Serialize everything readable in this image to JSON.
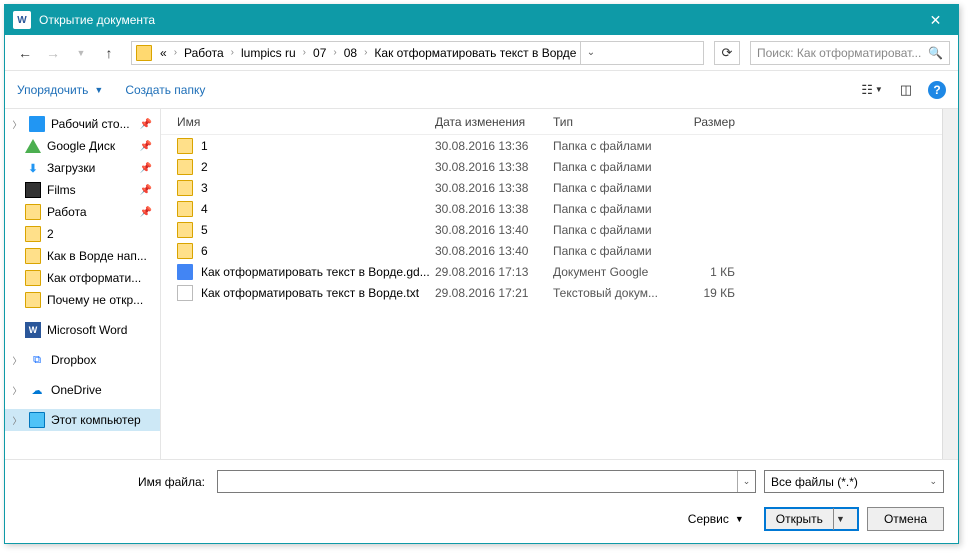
{
  "titlebar": {
    "app_badge": "W",
    "title": "Открытие документа"
  },
  "nav": {
    "breadcrumb": [
      "Работа",
      "lumpics ru",
      "07",
      "08",
      "Как отформатировать текст в Ворде"
    ],
    "search_placeholder": "Поиск: Как отформатироват..."
  },
  "toolbar": {
    "organize": "Упорядочить",
    "newfolder": "Создать папку"
  },
  "sidebar": [
    {
      "label": "Рабочий сто...",
      "icon": "desktop",
      "pin": true,
      "collapsible": true
    },
    {
      "label": "Google Диск",
      "icon": "gdrive",
      "pin": true
    },
    {
      "label": "Загрузки",
      "icon": "download",
      "pin": true
    },
    {
      "label": "Films",
      "icon": "films",
      "pin": true
    },
    {
      "label": "Работа",
      "icon": "folder",
      "pin": true
    },
    {
      "label": "2",
      "icon": "folder"
    },
    {
      "label": "Как в Ворде нап...",
      "icon": "folder"
    },
    {
      "label": "Как отформати...",
      "icon": "folder"
    },
    {
      "label": "Почему не откр...",
      "icon": "folder"
    },
    {
      "label": "",
      "icon": "spacer"
    },
    {
      "label": "Microsoft Word",
      "icon": "word"
    },
    {
      "label": "",
      "icon": "spacer"
    },
    {
      "label": "Dropbox",
      "icon": "dropbox",
      "collapsible": true
    },
    {
      "label": "",
      "icon": "spacer"
    },
    {
      "label": "OneDrive",
      "icon": "onedrive",
      "collapsible": true
    },
    {
      "label": "",
      "icon": "spacer"
    },
    {
      "label": "Этот компьютер",
      "icon": "pc",
      "collapsible": true,
      "selected": true
    }
  ],
  "columns": {
    "name": "Имя",
    "date": "Дата изменения",
    "type": "Тип",
    "size": "Размер"
  },
  "files": [
    {
      "icon": "folder",
      "name": "1",
      "date": "30.08.2016 13:36",
      "type": "Папка с файлами",
      "size": ""
    },
    {
      "icon": "folder",
      "name": "2",
      "date": "30.08.2016 13:38",
      "type": "Папка с файлами",
      "size": ""
    },
    {
      "icon": "folder",
      "name": "3",
      "date": "30.08.2016 13:38",
      "type": "Папка с файлами",
      "size": ""
    },
    {
      "icon": "folder",
      "name": "4",
      "date": "30.08.2016 13:38",
      "type": "Папка с файлами",
      "size": ""
    },
    {
      "icon": "folder",
      "name": "5",
      "date": "30.08.2016 13:40",
      "type": "Папка с файлами",
      "size": ""
    },
    {
      "icon": "folder",
      "name": "6",
      "date": "30.08.2016 13:40",
      "type": "Папка с файлами",
      "size": ""
    },
    {
      "icon": "gdoc",
      "name": "Как отформатировать текст в Ворде.gd...",
      "date": "29.08.2016 17:13",
      "type": "Документ Google",
      "size": "1 КБ"
    },
    {
      "icon": "txt",
      "name": "Как отформатировать текст в Ворде.txt",
      "date": "29.08.2016 17:21",
      "type": "Текстовый докум...",
      "size": "19 КБ"
    }
  ],
  "footer": {
    "filename_label": "Имя файла:",
    "filter": "Все файлы (*.*)",
    "tools": "Сервис",
    "open": "Открыть",
    "cancel": "Отмена"
  }
}
